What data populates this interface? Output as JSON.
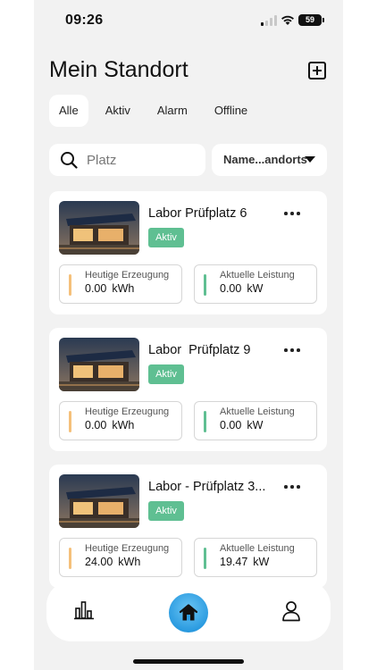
{
  "status_bar": {
    "time": "09:26",
    "battery": "59"
  },
  "header": {
    "title": "Mein Standort",
    "add_icon": "plus-square-icon"
  },
  "tabs": [
    {
      "label": "Alle",
      "active": true
    },
    {
      "label": "Aktiv",
      "active": false
    },
    {
      "label": "Alarm",
      "active": false
    },
    {
      "label": "Offline",
      "active": false
    }
  ],
  "search": {
    "placeholder": "Platz",
    "value": ""
  },
  "sort": {
    "label": "Name...andorts"
  },
  "colors": {
    "badge": "#5fbf92",
    "generation_bar": "#f5c07a",
    "power_bar": "#5fbf92",
    "home_button": "#2b9be0"
  },
  "sites": [
    {
      "name": "Labor Prüfplatz 6",
      "status": "Aktiv",
      "generation_label": "Heutige Erzeugung",
      "generation_value": "0.00",
      "generation_unit": "kWh",
      "power_label": "Aktuelle Leistung",
      "power_value": "0.00",
      "power_unit": "kW"
    },
    {
      "name": "Labor  Prüfplatz 9",
      "status": "Aktiv",
      "generation_label": "Heutige Erzeugung",
      "generation_value": "0.00",
      "generation_unit": "kWh",
      "power_label": "Aktuelle Leistung",
      "power_value": "0.00",
      "power_unit": "kW"
    },
    {
      "name": "Labor - Prüfplatz 3...",
      "status": "Aktiv",
      "generation_label": "Heutige Erzeugung",
      "generation_value": "24.00",
      "generation_unit": "kWh",
      "power_label": "Aktuelle Leistung",
      "power_value": "19.47",
      "power_unit": "kW"
    }
  ],
  "bottom_nav": {
    "items": [
      "stats-icon",
      "home-icon",
      "profile-icon"
    ],
    "active": "home-icon"
  }
}
